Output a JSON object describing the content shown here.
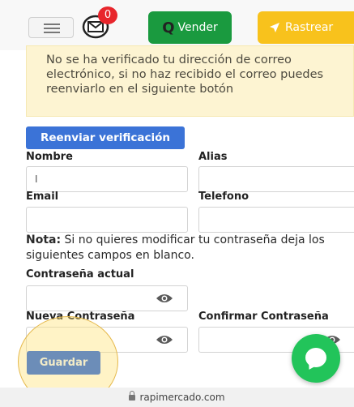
{
  "header": {
    "notification_count": "0",
    "vender_label": "Vender",
    "rastrear_label": "Rastrear"
  },
  "alert": {
    "message": "No se ha verificado tu dirección de correo electrónico, si no haz recibido el correo puedes reenviarlo en el siguiente botón"
  },
  "resend_button_label": "Reenviar verificación",
  "form": {
    "nombre_label": "Nombre",
    "nombre_value": "I",
    "alias_label": "Alias",
    "email_label": "Email",
    "telefono_label": "Telefono",
    "note_bold": "Nota:",
    "note_text": " Si no quieres modificar tu contraseña deja los siguientes campos en blanco.",
    "current_password_label": "Contraseña actual",
    "new_password_label": "Nueva Contraseña",
    "confirm_password_label": "Confirmar Contraseña",
    "save_label": "Guardar"
  },
  "browser": {
    "url": "rapimercado.com"
  },
  "colors": {
    "vender_green": "#1a9a3f",
    "rastrear_yellow": "#f8c21c",
    "resend_blue": "#3b73d7",
    "save_blue": "#6c8db8",
    "chat_green": "#22c45a",
    "alert_bg": "#fdf4d2"
  }
}
